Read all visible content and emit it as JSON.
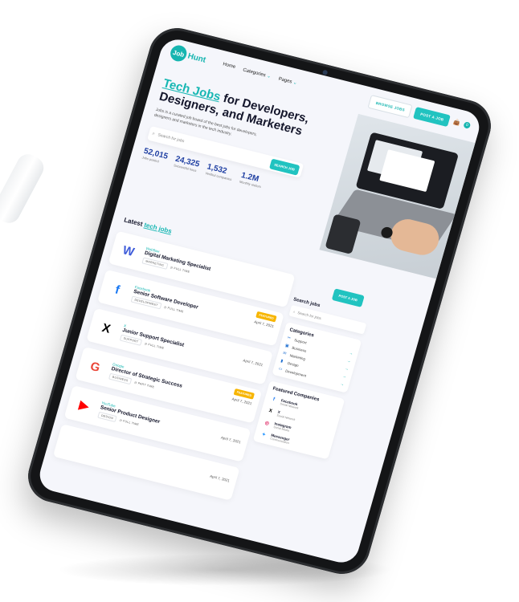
{
  "brand": {
    "logo_mark": "Job",
    "logo_word": "Hunt"
  },
  "nav": {
    "home": "Home",
    "categories": "Categories",
    "pages": "Pages"
  },
  "header_actions": {
    "browse": "BROWSE JOBS",
    "post": "POST A JOB",
    "cart_count": "0"
  },
  "hero": {
    "title_accent": "Tech Jobs",
    "title_rest": " for Developers, Designers, and Marketers",
    "description": "Jobs is a curated job board of the best jobs for developers, designers and marketers in the tech industry.",
    "search_placeholder": "Search for jobs",
    "search_button": "SEARCH JOB",
    "stats": [
      {
        "value": "52,015",
        "label": "Jobs posted"
      },
      {
        "value": "24,325",
        "label": "Successful hires"
      },
      {
        "value": "1,532",
        "label": "Verified companies"
      },
      {
        "value": "1.2M",
        "label": "Monthly visitors"
      }
    ]
  },
  "latest": {
    "prefix": "Latest ",
    "accent": "tech jobs"
  },
  "jobs": [
    {
      "company": "Webflow",
      "title": "Digital Marketing Specialist",
      "tag": "MARKETING",
      "type": "FULL TIME",
      "date": "",
      "featured": "",
      "logo": "W",
      "logo_color": "#3d5bd9"
    },
    {
      "company": "Facebook",
      "title": "Senior Software Developer",
      "tag": "DEVELOPMENT",
      "type": "FULL TIME",
      "date": "April 7, 2021",
      "featured": "FEATURED",
      "logo": "f",
      "logo_color": "#1877f2"
    },
    {
      "company": "X",
      "title": "Junior Support Specialist",
      "tag": "SUPPORT",
      "type": "FULL TIME",
      "date": "April 7, 2021",
      "featured": "",
      "logo": "X",
      "logo_color": "#000000"
    },
    {
      "company": "Google",
      "title": "Director of Strategic Success",
      "tag": "BUSINESS",
      "type": "PART TIME",
      "date": "April 7, 2021",
      "featured": "FEATURED",
      "logo": "G",
      "logo_color": "#ea4335"
    },
    {
      "company": "YouTube",
      "title": "Senior Product Designer",
      "tag": "DESIGN",
      "type": "FULL TIME",
      "date": "April 7, 2021",
      "featured": "",
      "logo": "▶",
      "logo_color": "#ff0000"
    }
  ],
  "last_date": "April 7, 2021",
  "sidebar": {
    "post_button": "POST A JOB",
    "search_title": "Search jobs",
    "search_placeholder": "Search for jobs",
    "categories_title": "Categories",
    "categories": [
      "Support",
      "Business",
      "Marketing",
      "Design",
      "Development"
    ],
    "companies_title": "Featured Companies",
    "companies": [
      {
        "name": "Facebook",
        "sub": "Social Network",
        "icon": "f",
        "color": "#1877f2"
      },
      {
        "name": "X",
        "sub": "Social Network",
        "icon": "X",
        "color": "#000000"
      },
      {
        "name": "Instagram",
        "sub": "Social Media",
        "icon": "◎",
        "color": "#e1306c"
      },
      {
        "name": "Messenger",
        "sub": "Communication",
        "icon": "✦",
        "color": "#0084ff"
      }
    ]
  }
}
